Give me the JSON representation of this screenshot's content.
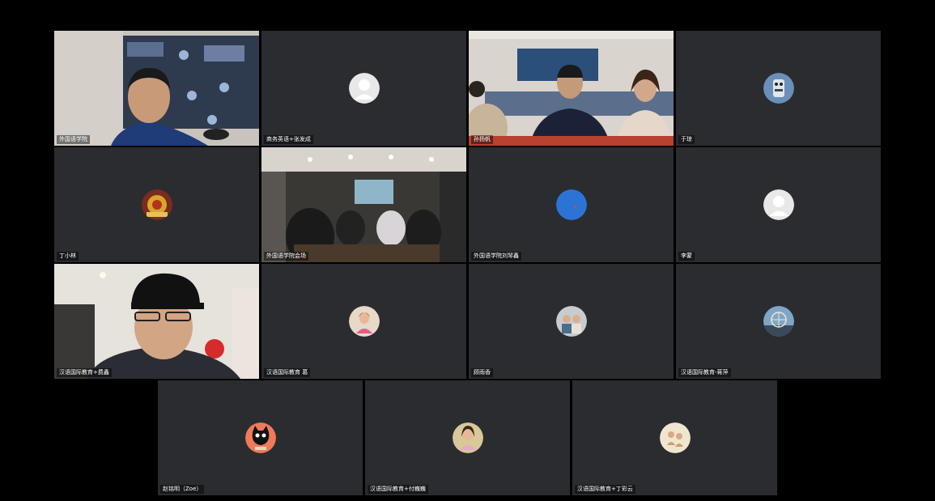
{
  "meeting": {
    "participants": [
      {
        "name": "外国语学院",
        "video": true,
        "avatar": "person-video"
      },
      {
        "name": "商务英语+张发成",
        "video": false,
        "avatar": "default-person-icon"
      },
      {
        "name": "孙扬帆",
        "video": true,
        "avatar": "conference-room-video"
      },
      {
        "name": "于琼",
        "video": false,
        "avatar": "robot-icon"
      },
      {
        "name": "丁小林",
        "video": false,
        "avatar": "ornament-icon"
      },
      {
        "name": "外国语学院会场",
        "video": true,
        "avatar": "lecture-hall-video"
      },
      {
        "name": "外国语学院刘琴鑫",
        "video": false,
        "avatar": "blue-circle-icon"
      },
      {
        "name": "李蒙",
        "video": false,
        "avatar": "default-person-icon"
      },
      {
        "name": "汉语国际教育+费鑫",
        "video": true,
        "avatar": "person-cap-video",
        "active": true
      },
      {
        "name": "汉语国际教育 葛",
        "video": false,
        "avatar": "girl-photo-icon"
      },
      {
        "name": "顾雨香",
        "video": false,
        "avatar": "couple-photo-icon"
      },
      {
        "name": "汉语国际教育-蒋萍",
        "video": false,
        "avatar": "ferris-wheel-icon"
      },
      {
        "name": "赵铭明（Zoe）",
        "video": false,
        "avatar": "black-cat-icon"
      },
      {
        "name": "汉语国际教育+付巍巍",
        "video": false,
        "avatar": "girl-photo-icon"
      },
      {
        "name": "汉语国际教育+丁彩云",
        "video": false,
        "avatar": "kids-photo-icon"
      }
    ]
  }
}
